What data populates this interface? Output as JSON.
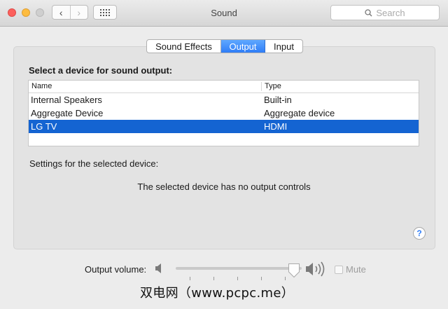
{
  "window": {
    "title": "Sound"
  },
  "toolbar": {
    "search_placeholder": "Search"
  },
  "tabs": [
    {
      "label": "Sound Effects",
      "selected": false
    },
    {
      "label": "Output",
      "selected": true
    },
    {
      "label": "Input",
      "selected": false
    }
  ],
  "output": {
    "heading": "Select a device for sound output:",
    "columns": [
      "Name",
      "Type"
    ],
    "devices": [
      {
        "name": "Internal Speakers",
        "type": "Built-in"
      },
      {
        "name": "Aggregate Device",
        "type": "Aggregate device"
      },
      {
        "name": "LG TV",
        "type": "HDMI"
      }
    ],
    "selected_index": 2,
    "settings_label": "Settings for the selected device:",
    "no_controls_message": "The selected device has no output controls"
  },
  "help": {
    "label": "?"
  },
  "volume": {
    "label": "Output volume:",
    "level": 0.94,
    "mute_label": "Mute",
    "muted": false
  },
  "watermark": "双电网（www.pcpc.me）",
  "colors": {
    "selection": "#1464d2",
    "tab_selected": "#2f7df7"
  }
}
